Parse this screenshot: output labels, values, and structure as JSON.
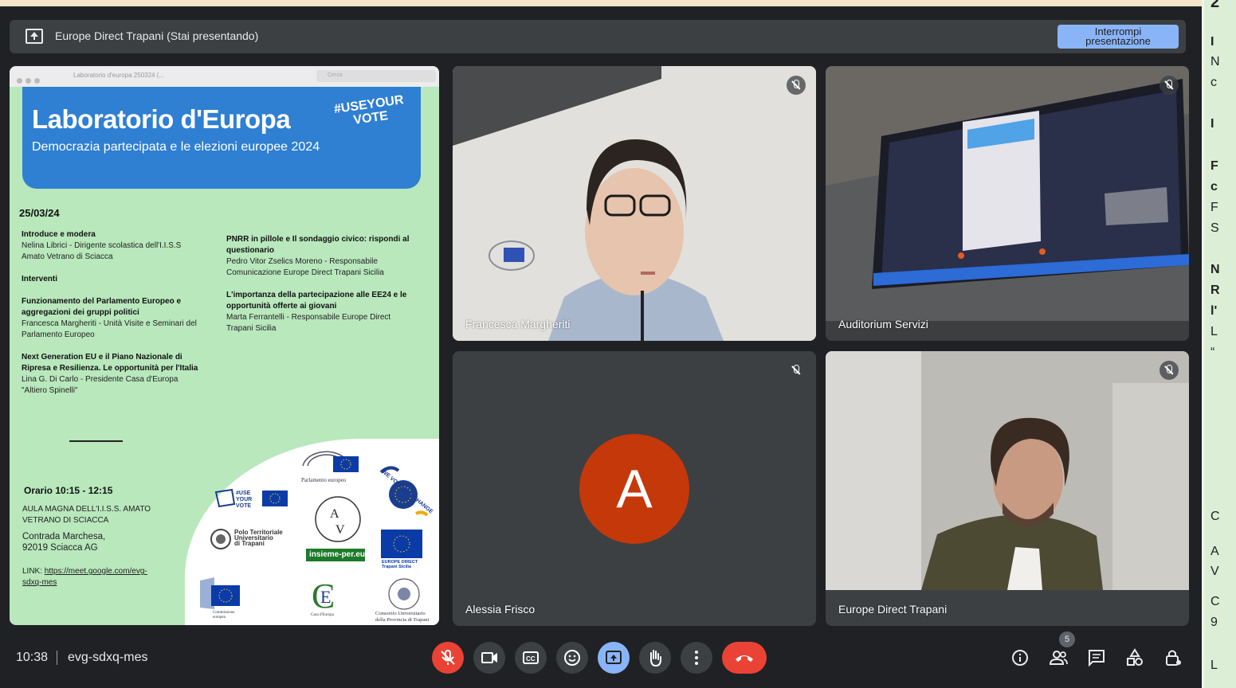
{
  "presentation_bar": {
    "title": "Europe Direct Trapani (Stai presentando)",
    "stop_button_line1": "Interrompi",
    "stop_button_line2": "presentazione"
  },
  "slide": {
    "window_title": "Laboratorio d'europa 250324 (...",
    "search_placeholder": "Cerca",
    "title": "Laboratorio d'Europa",
    "hashtag_line1": "#USEYOUR",
    "hashtag_line2": "VOTE",
    "subtitle": "Democrazia partecipata e le elezioni europee 2024",
    "date": "25/03/24",
    "left_items": [
      {
        "head": "Introduce e modera",
        "body": "Nelina Librici - Dirigente scolastica dell'I.I.S.S Amato Vetrano di Sciacca"
      },
      {
        "head": "Interventi",
        "body": ""
      },
      {
        "head": "Funzionamento del Parlamento Europeo e aggregazioni dei gruppi politici",
        "body": "Francesca Margheriti - Unità Visite e Seminari del Parlamento Europeo"
      },
      {
        "head": "Next Generation EU e il Piano Nazionale di Ripresa e Resilienza. Le opportunità per l'Italia",
        "body": "Lina G. Di Carlo - Presidente Casa d'Europa \"Altiero Spinelli\""
      }
    ],
    "right_items": [
      {
        "head": "PNRR in pillole e Il sondaggio civico: rispondi al questionario",
        "body": "Pedro Vitor Zselics Moreno - Responsabile Comunicazione Europe Direct Trapani Sicilia"
      },
      {
        "head": "L'importanza della partecipazione alle EE24 e le opportunità offerte ai giovani",
        "body": "Marta Ferrantelli - Responsabile Europe Direct Trapani Sicilia"
      }
    ],
    "time_label": "Orario 10:15 - 12:15",
    "venue_line1": "AULA MAGNA DELL'I.I.S.S. AMATO",
    "venue_line2": "VETRANO DI SCIACCA",
    "address_line1": "Contrada Marchesa,",
    "address_line2": "92019 Sciacca AG",
    "link_label": "LINK: ",
    "link_url_line1": "https://meet.google.com/evg-",
    "link_url_line2": "sdxq-mes",
    "logos": {
      "parlamento": "Parlamento europeo",
      "useyourvote": "#USE YOUR VOTE",
      "polo_line1": "Polo Territoriale",
      "polo_line2": "Universitario",
      "polo_line3": "di Trapani",
      "insieme": "insieme-per.eu",
      "wevote": "WE VOTE FOR CHANGE",
      "europe_direct_line1": "EUROPE DIRECT",
      "europe_direct_line2": "Trapani Sicilia",
      "commissione": "Commissione europea",
      "casa_europa": "Casa d'Europa",
      "consorzio_line1": "Consorzio Universitario",
      "consorzio_line2": "della Provincia di Trapani"
    }
  },
  "participants": [
    {
      "name": "Francesca Margheriti"
    },
    {
      "name": "Auditorium Servizi"
    },
    {
      "name": "Alessia Frisco",
      "initial": "A"
    },
    {
      "name": "Europe Direct Trapani"
    }
  ],
  "meeting": {
    "time": "10:38",
    "code": "evg-sdxq-mes",
    "people_count": "5"
  },
  "colors": {
    "background": "#202124",
    "accent_blue": "#8ab4f8",
    "danger_red": "#ea4335",
    "avatar_orange": "#c5380a",
    "slide_green": "#b8e8bc"
  },
  "side_panel_fragments": [
    "2",
    "I",
    "N",
    "c",
    "I",
    "F",
    "c",
    "F",
    "S",
    "N",
    "R",
    "l'",
    "L",
    "“",
    "C",
    "A",
    "V",
    "C",
    "9",
    "L"
  ]
}
